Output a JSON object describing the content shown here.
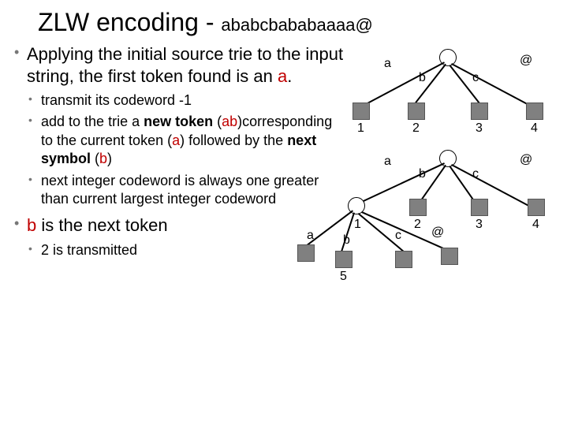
{
  "title": {
    "main": "ZLW encoding",
    "sep": "-",
    "sub": "ababcbababaaaa@"
  },
  "bullets": {
    "main1_pre": "Applying the initial source trie to the input string, the first token found is an ",
    "main1_a": "a",
    "main1_post": ".",
    "sub1": "transmit its codeword -1",
    "sub2_pre": "add to the trie a ",
    "sub2_bold1": "new token",
    "sub2_mid1": " (",
    "sub2_ab": "ab",
    "sub2_mid2": ")corresponding to the current token (",
    "sub2_a": "a",
    "sub2_mid3": ") followed by the ",
    "sub2_bold2": "next symbol",
    "sub2_mid4": " (",
    "sub2_b": "b",
    "sub2_mid5": ")",
    "sub3": "next integer codeword is always one greater than current largest integer codeword",
    "main2_b": "b",
    "main2_post": " is the next token",
    "sub4": "2 is transmitted"
  },
  "trie1": {
    "edge_a": "a",
    "edge_b": "b",
    "edge_c": "c",
    "edge_at": "@",
    "leaf1": "1",
    "leaf2": "2",
    "leaf3": "3",
    "leaf4": "4"
  },
  "trie2": {
    "edge_a": "a",
    "edge_b": "b",
    "edge_c": "c",
    "edge_at": "@",
    "leaf1": "1",
    "leaf2": "2",
    "leaf3": "3",
    "leaf4": "4",
    "leaf5": "5",
    "child_a": "a",
    "child_b": "b",
    "child_c": "c",
    "child_at": "@"
  }
}
